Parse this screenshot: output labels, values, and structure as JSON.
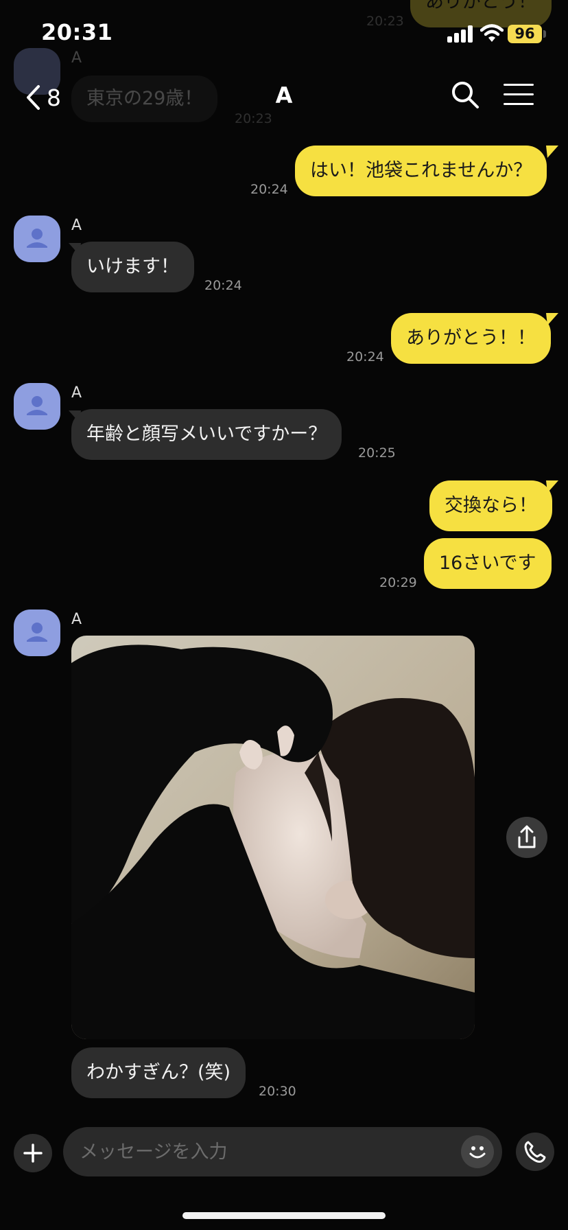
{
  "status_bar": {
    "time": "20:31",
    "battery": "96"
  },
  "ghost": {
    "top_bubble": "ありがとう！",
    "top_time": "20:23",
    "sender": "A",
    "bubble": "東京の29歳！",
    "time": "20:23"
  },
  "header": {
    "back_count": "8",
    "title": "A"
  },
  "messages": [
    {
      "from": "me",
      "text": "はい！池袋これませんか？",
      "time": "20:24"
    },
    {
      "from": "them",
      "sender": "A",
      "text": "いけます！",
      "time": "20:24"
    },
    {
      "from": "me",
      "text": "ありがとう！！",
      "time": "20:24"
    },
    {
      "from": "them",
      "sender": "A",
      "text": "年齢と顔写メいいですかー？",
      "time": "20:25"
    },
    {
      "from": "me",
      "text": "交換なら！"
    },
    {
      "from": "me",
      "text": "16さいです",
      "time": "20:29"
    },
    {
      "from": "them",
      "sender": "A",
      "text": "わかすぎん？(笑)",
      "time": "20:30"
    }
  ],
  "input": {
    "placeholder": "メッセージを入力"
  },
  "colors": {
    "my_bubble": "#f6e041",
    "their_bubble": "#2d2d2d",
    "avatar": "#8e9ee0",
    "background": "#060606"
  }
}
